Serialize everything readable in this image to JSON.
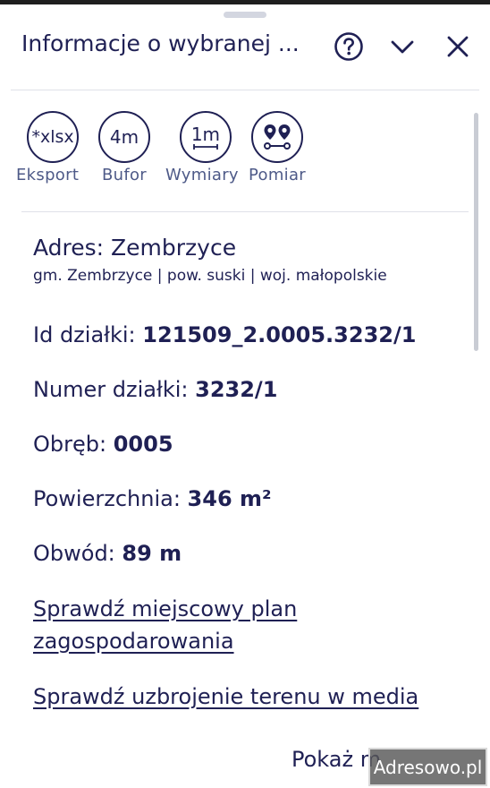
{
  "header": {
    "title": "Informacje o wybranej ...",
    "help_icon": "help-circle-icon",
    "collapse_icon": "chevron-down-icon",
    "close_icon": "close-icon"
  },
  "tools": [
    {
      "id": "export",
      "icon_text": "*xlsx",
      "label": "Eksport"
    },
    {
      "id": "buffer",
      "icon_text": "4m",
      "label": "Bufor"
    },
    {
      "id": "dimensions",
      "icon_text": "1m",
      "label": "Wymiary"
    },
    {
      "id": "measure",
      "icon": "measure-pins-icon",
      "label": "Pomiar"
    }
  ],
  "address": {
    "title": "Adres: Zembrzyce",
    "subtitle": "gm. Zembrzyce | pow. suski | woj. małopolskie"
  },
  "details": [
    {
      "label": "Id działki: ",
      "value": "121509_2.0005.3232/1"
    },
    {
      "label": "Numer działki: ",
      "value": "3232/1"
    },
    {
      "label": "Obręb: ",
      "value": "0005"
    },
    {
      "label": "Powierzchnia: ",
      "value": "346 m²"
    },
    {
      "label": "Obwód: ",
      "value": "89 m"
    }
  ],
  "links": {
    "plan_line1": "Sprawdź miejscowy plan",
    "plan_line2": "zagospodarowania",
    "utilities": "Sprawdź uzbrojenie terenu w media"
  },
  "footer": {
    "show_more": "Pokaż m",
    "watermark": "Adresowo.pl"
  },
  "colors": {
    "text": "#1f2054",
    "label_muted": "#4e5a88",
    "divider": "#dfe1e8"
  }
}
